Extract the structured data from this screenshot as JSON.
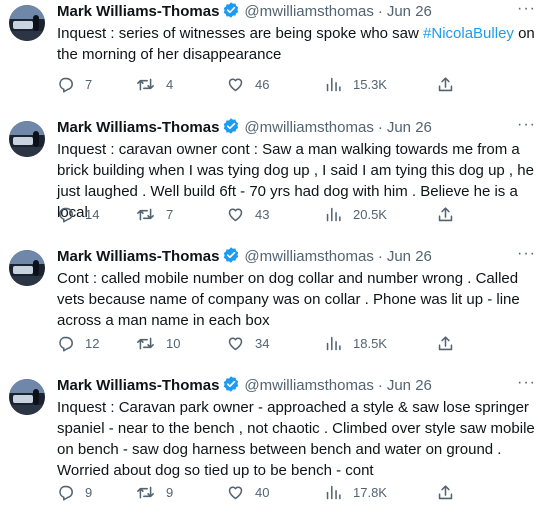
{
  "tweets": [
    {
      "name": "Mark Williams-Thomas",
      "handle": "@mwilliamsthomas",
      "dot": "·",
      "date": "Jun 26",
      "text_before": "Inquest : series of witnesses are being spoke who saw ",
      "hashtag": "#NicolaBulley",
      "text_after": " on the morning of her disappearance",
      "replies": "7",
      "retweets": "4",
      "likes": "46",
      "views": "15.3K"
    },
    {
      "name": "Mark Williams-Thomas",
      "handle": "@mwilliamsthomas",
      "dot": "·",
      "date": "Jun 26",
      "text": "Inquest : caravan owner cont  : Saw a man walking towards me from a brick building when I was tying dog up , I said I am tying this dog up , he just laughed . Well build 6ft - 70 yrs had dog with him . Believe he is a local",
      "replies": "14",
      "retweets": "7",
      "likes": "43",
      "views": "20.5K"
    },
    {
      "name": "Mark Williams-Thomas",
      "handle": "@mwilliamsthomas",
      "dot": "·",
      "date": "Jun 26",
      "text": "Cont : called mobile number on dog collar and number wrong . Called vets because name of company was on collar . Phone was lit up - line across a man name in each box",
      "replies": "12",
      "retweets": "10",
      "likes": "34",
      "views": "18.5K"
    },
    {
      "name": "Mark Williams-Thomas",
      "handle": "@mwilliamsthomas",
      "dot": "·",
      "date": "Jun 26",
      "text": "Inquest :  Caravan park owner - approached a style & saw lose springer spaniel - near to the bench , not chaotic . Climbed over style saw mobile on bench - saw dog harness between bench and water on ground . Worried about dog so tied up to be bench - cont",
      "replies": "9",
      "retweets": "9",
      "likes": "40",
      "views": "17.8K"
    }
  ],
  "icons": {
    "more": "more-dots-icon",
    "verified": "verified-badge-icon",
    "reply": "reply-icon",
    "retweet": "retweet-icon",
    "like": "heart-icon",
    "views": "views-icon",
    "share": "share-icon"
  },
  "colors": {
    "text": "#0f1419",
    "secondary": "#536471",
    "accent": "#1d9bf0"
  },
  "more_label": "···"
}
